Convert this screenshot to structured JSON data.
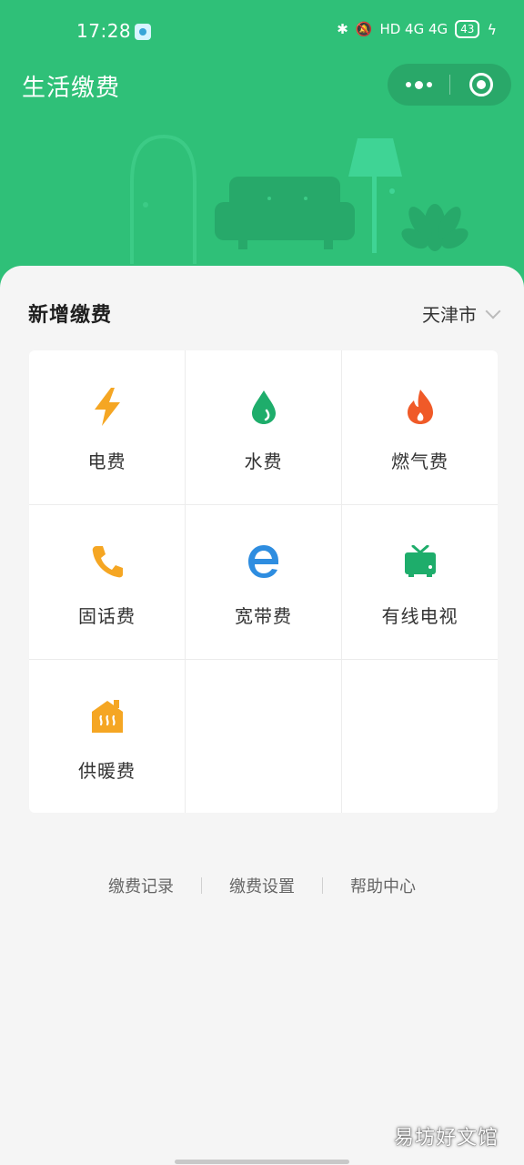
{
  "status_bar": {
    "time": "17:28",
    "network_labels": "HD 4G 4G",
    "battery": "43"
  },
  "header": {
    "title": "生活缴费",
    "capsule_more_icon": "more-dots-icon",
    "capsule_close_icon": "target-close-icon"
  },
  "colors": {
    "brand_green": "#2fc078",
    "electric": "#f5a623",
    "water": "#1ead6b",
    "gas": "#f05a28",
    "phone": "#f5a623",
    "broadband": "#2e8de0",
    "tv": "#1ead6b",
    "heating": "#f5a623"
  },
  "main": {
    "section_title": "新增缴费",
    "city": "天津市",
    "services": [
      {
        "label": "电费",
        "icon": "lightning-icon"
      },
      {
        "label": "水费",
        "icon": "water-drop-icon"
      },
      {
        "label": "燃气费",
        "icon": "flame-icon"
      },
      {
        "label": "固话费",
        "icon": "phone-icon"
      },
      {
        "label": "宽带费",
        "icon": "browser-e-icon"
      },
      {
        "label": "有线电视",
        "icon": "tv-icon"
      },
      {
        "label": "供暖费",
        "icon": "heating-house-icon"
      }
    ]
  },
  "footer_links": [
    "缴费记录",
    "缴费设置",
    "帮助中心"
  ],
  "watermark": "易坊好文馆"
}
